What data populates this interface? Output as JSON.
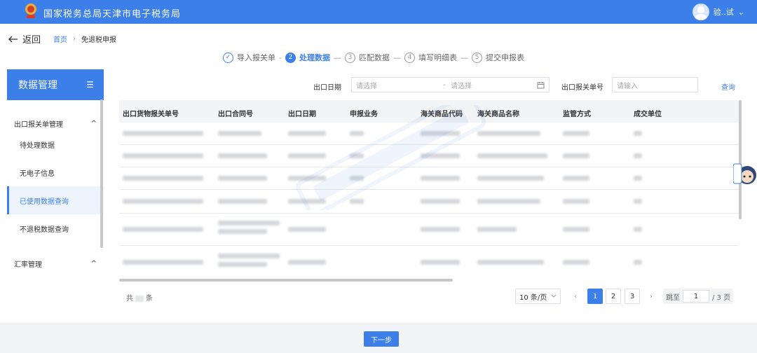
{
  "header": {
    "title": "国家税务总局天津市电子税务局",
    "user_name": "验..试",
    "user_caret": "⌄"
  },
  "nav": {
    "back_label": "返回",
    "breadcrumb_home": "首页",
    "breadcrumb_sep": "›",
    "breadcrumb_current": "免退税申报"
  },
  "steps": [
    {
      "num": "✓",
      "label": "导入报关单",
      "state": "done"
    },
    {
      "num": "2",
      "label": "处理数据",
      "state": "active"
    },
    {
      "num": "3",
      "label": "匹配数据",
      "state": "todo"
    },
    {
      "num": "4",
      "label": "填写明细表",
      "state": "todo"
    },
    {
      "num": "5",
      "label": "提交申报表",
      "state": "todo"
    }
  ],
  "step_separators": [
    "-",
    "—",
    "—",
    "—"
  ],
  "sidebar": {
    "title": "数据管理",
    "collapse_icon": "☰",
    "group1": {
      "label": "出口报关单管理",
      "caret": "^"
    },
    "items": [
      {
        "label": "待处理数据",
        "active": false
      },
      {
        "label": "无电子信息",
        "active": false
      },
      {
        "label": "已使用数据查询",
        "active": true
      },
      {
        "label": "不退税数据查询",
        "active": false
      }
    ],
    "group2": {
      "label": "汇率管理",
      "caret": "^"
    }
  },
  "filters": {
    "date_label": "出口日期",
    "date_start_placeholder": "请选择",
    "date_sep": "-",
    "date_end_placeholder": "请选择",
    "declaration_label": "出口报关单号",
    "declaration_placeholder": "请输入",
    "query_label": "查询"
  },
  "table": {
    "columns": [
      "出口货物报关单号",
      "出口合同号",
      "出口日期",
      "申报业务",
      "海关商品代码",
      "海关商品名称",
      "监管方式",
      "成交单位"
    ]
  },
  "pagination": {
    "total_prefix": "共",
    "total_suffix": "条",
    "page_size": "10 条/页",
    "prev": "‹",
    "pages": [
      "1",
      "2",
      "3"
    ],
    "current_page": 1,
    "next": "›",
    "jump_label": "跳至",
    "jump_value": "1",
    "page_total": "/ 3 页"
  },
  "footer": {
    "next_label": "下一步"
  },
  "colors": {
    "primary": "#3d7fe8",
    "header_bg": "#3d7fe8",
    "table_head_bg": "#f3f4f6"
  }
}
